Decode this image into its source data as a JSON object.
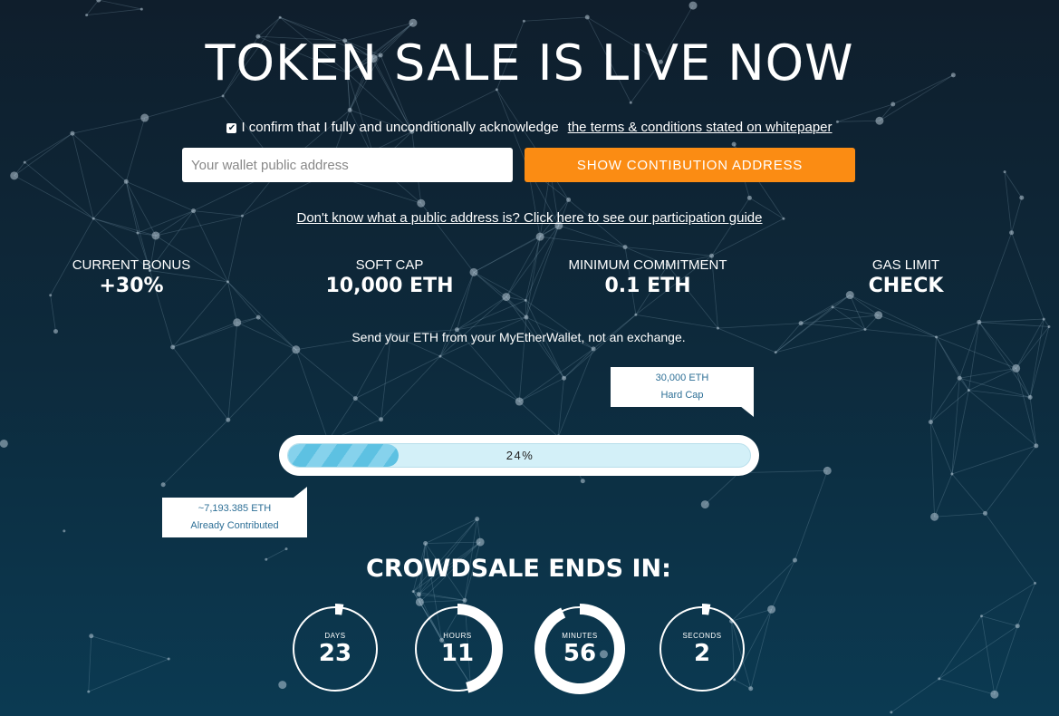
{
  "header": {
    "title": "TOKEN SALE IS LIVE NOW"
  },
  "confirm": {
    "checked": true,
    "text": "I confirm that I fully and unconditionally acknowledge",
    "link_text": "the terms & conditions stated on whitepaper"
  },
  "wallet": {
    "placeholder": "Your wallet public address",
    "value": "",
    "button_label": "SHOW CONTIBUTION ADDRESS"
  },
  "guide_link": "Don't know what a public address is? Click here to see our participation guide",
  "stats": [
    {
      "label": "CURRENT BONUS",
      "value": "+30%"
    },
    {
      "label": "SOFT CAP",
      "value": "10,000 ETH"
    },
    {
      "label": "MINIMUM COMMITMENT",
      "value": "0.1 ETH"
    },
    {
      "label": "GAS LIMIT",
      "value": "CHECK"
    }
  ],
  "send_note": "Send your ETH from your MyEtherWallet, not an exchange.",
  "hard_cap": {
    "amount": "30,000 ETH",
    "label": "Hard Cap"
  },
  "contributed": {
    "amount": "~7,193.385 ETH",
    "label": "Already Contributed"
  },
  "progress": {
    "percent": 24,
    "text": "24%"
  },
  "countdown": {
    "title": "CROWDSALE ENDS IN:",
    "units": [
      {
        "label": "DAYS",
        "value": "23",
        "fraction": 0.03
      },
      {
        "label": "HOURS",
        "value": "11",
        "fraction": 0.46
      },
      {
        "label": "MINUTES",
        "value": "56",
        "fraction": 0.93
      },
      {
        "label": "SECONDS",
        "value": "2",
        "fraction": 0.03
      }
    ]
  },
  "colors": {
    "accent_button": "#fb8c13",
    "progress_fill": "#5dc1e2",
    "progress_track": "#d3f0f8",
    "bubble_text": "#2d6f96"
  }
}
